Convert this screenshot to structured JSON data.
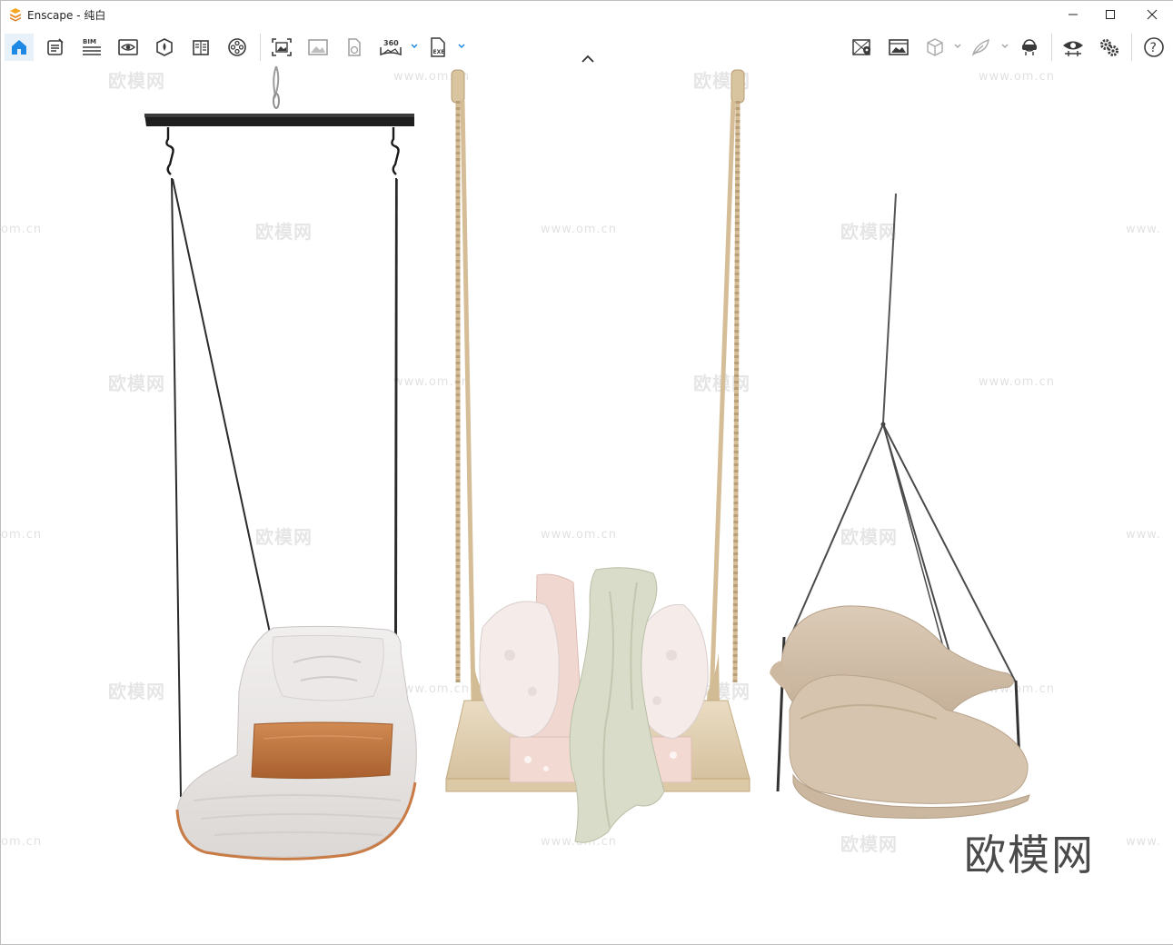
{
  "window": {
    "app_name": "Enscape",
    "title": "Enscape - 纯白",
    "controls": {
      "minimize": "minimize",
      "maximize": "maximize",
      "close": "close"
    }
  },
  "toolbar": {
    "left_group": [
      {
        "name": "home",
        "icon": "home-icon",
        "active": true
      },
      {
        "name": "notes",
        "icon": "notes-icon"
      },
      {
        "name": "bim",
        "icon": "bim-icon",
        "label": "BIM"
      },
      {
        "name": "view-settings",
        "icon": "eye-panel-icon"
      },
      {
        "name": "asset-library",
        "icon": "asset-library-icon"
      },
      {
        "name": "material-editor",
        "icon": "book-icon"
      },
      {
        "name": "video-editor",
        "icon": "film-reel-icon"
      }
    ],
    "capture_group": [
      {
        "name": "screenshot",
        "icon": "screenshot-icon"
      },
      {
        "name": "batch-render",
        "icon": "image-icon"
      },
      {
        "name": "web-standalone",
        "icon": "web-upload-icon"
      },
      {
        "name": "panorama",
        "icon": "panorama-360-icon",
        "label": "360"
      },
      {
        "name": "export-exe",
        "icon": "export-exe-icon",
        "label": "EXE"
      }
    ],
    "right_group": [
      {
        "name": "collaborative-annotation",
        "icon": "map-pin-icon"
      },
      {
        "name": "render-settings",
        "icon": "image-grid-icon"
      },
      {
        "name": "cube",
        "icon": "cube-icon"
      },
      {
        "name": "feather",
        "icon": "feather-icon"
      },
      {
        "name": "vr-headset",
        "icon": "vr-headset-icon"
      },
      {
        "name": "visual-settings",
        "icon": "eye-settings-icon"
      },
      {
        "name": "general-settings",
        "icon": "gears-icon"
      },
      {
        "name": "help",
        "icon": "help-icon",
        "label": "?"
      }
    ]
  },
  "viewport": {
    "watermark_text": "欧模网",
    "watermark_url": "www.om.cn",
    "watermark_fragment": "om.cn",
    "watermark_fragment_right": "www.",
    "brand_watermark": "欧模网",
    "objects": [
      "hanging-chair-white",
      "rope-swing-bench",
      "hanging-chair-beige"
    ]
  },
  "colors": {
    "accent": "#1e88e5",
    "toolbar_icon": "#3a3a3a",
    "cushion_orange": "#c77a42",
    "rope": "#d8c09a",
    "beige": "#d2bfa8"
  }
}
